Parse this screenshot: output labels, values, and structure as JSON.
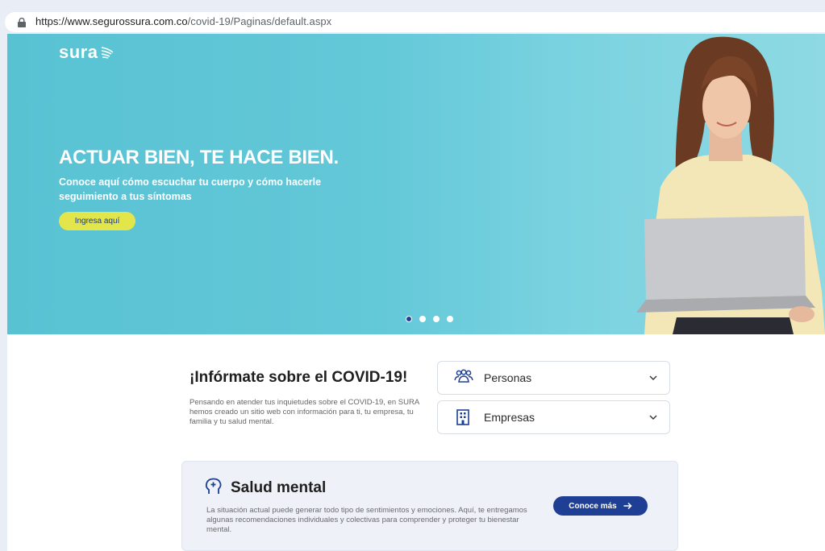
{
  "browser": {
    "url_host": "https://www.segurossura.com.co",
    "url_path": "/covid-19/Paginas/default.aspx"
  },
  "hero": {
    "logo_text": "sura",
    "title": "ACTUAR BIEN, TE HACE BIEN.",
    "subtitle": "Conoce aquí cómo escuchar tu cuerpo y cómo hacerle seguimiento a tus síntomas",
    "button_label": "Ingresa aquí",
    "slides_count": 4,
    "active_slide": 1
  },
  "info": {
    "title": "¡Infórmate sobre el COVID-19!",
    "text": "Pensando en atender tus inquietudes sobre el COVID-19, en SURA hemos creado un sitio web con información para ti, tu empresa, tu familia y tu salud mental."
  },
  "dropdowns": [
    {
      "label": "Personas",
      "icon": "people-group-icon"
    },
    {
      "label": "Empresas",
      "icon": "building-icon"
    }
  ],
  "salud": {
    "title": "Salud mental",
    "icon": "head-plus-icon",
    "text": "La situación actual puede generar todo tipo de sentimientos y emociones. Aquí, te entregamos algunas recomendaciones individuales y colectivas para comprender y proteger tu bienestar mental.",
    "button_label": "Conoce más"
  },
  "colors": {
    "hero_bg": "#63c8d8",
    "accent_yellow": "#e2e64a",
    "brand_blue": "#1e3f94"
  }
}
